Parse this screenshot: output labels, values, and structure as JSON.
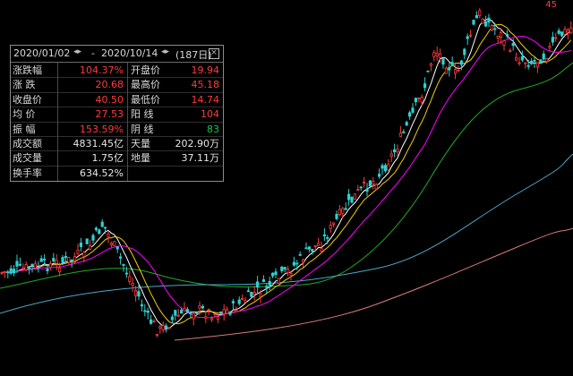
{
  "chart_data": {
    "type": "candlestick",
    "series": [
      {
        "name": "",
        "values": []
      }
    ]
  },
  "corner_value": "45",
  "panel": {
    "date_start": "2020/01/02",
    "date_sep": "-",
    "date_end": "2020/10/14",
    "days": "(187日)",
    "rows": [
      {
        "l1": "涨跌幅",
        "v1": "104.37%",
        "c1": "red",
        "l2": "开盘价",
        "v2": "19.94",
        "c2": "red"
      },
      {
        "l1": "涨  跌",
        "v1": "20.68",
        "c1": "red",
        "l2": "最高价",
        "v2": "45.18",
        "c2": "red"
      },
      {
        "l1": "收盘价",
        "v1": "40.50",
        "c1": "red",
        "l2": "最低价",
        "v2": "14.74",
        "c2": "red"
      },
      {
        "l1": "均  价",
        "v1": "27.53",
        "c1": "red",
        "l2": "阳  线",
        "v2": "104",
        "c2": "red"
      },
      {
        "l1": "振  幅",
        "v1": "153.59%",
        "c1": "red",
        "l2": "阴  线",
        "v2": "83",
        "c2": "green"
      },
      {
        "l1": "成交额",
        "v1": "4831.45亿",
        "c1": "white",
        "l2": "天量",
        "v2": "202.90万",
        "c2": "white"
      },
      {
        "l1": "成交量",
        "v1": "1.75亿",
        "c1": "white",
        "l2": "地量",
        "v2": "37.11万",
        "c2": "white"
      },
      {
        "l1": "换手率",
        "v1": "634.52%",
        "c1": "white",
        "l2": "",
        "v2": "",
        "c2": "white"
      }
    ]
  },
  "colors": {
    "up": "#ff3b3b",
    "down": "#2fd0d0",
    "ma5": "#ffffff",
    "ma10": "#f2d100",
    "ma20": "#ff00ff",
    "ma60": "#22aa22",
    "ma120": "#4aa7c9",
    "ma250": "#d77a7a"
  }
}
